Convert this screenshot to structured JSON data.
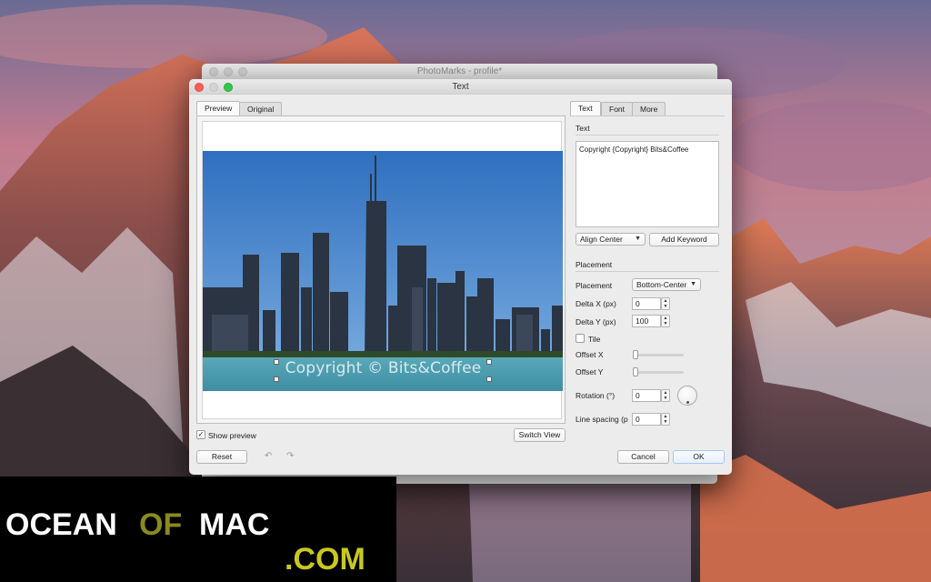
{
  "bg_window": {
    "title": "PhotoMarks - profile*"
  },
  "dialog": {
    "title": "Text",
    "left_tabs": [
      "Preview",
      "Original"
    ],
    "preview": {
      "watermark_text": "Copyright © Bits&Coffee",
      "show_preview_label": "Show preview",
      "show_preview_checked": true,
      "switch_view_label": "Switch View"
    },
    "reset_label": "Reset",
    "undo_icon": "undo-arrow-icon",
    "redo_icon": "redo-arrow-icon",
    "right_tabs": [
      "Text",
      "Font",
      "More"
    ],
    "text_section": {
      "title": "Text",
      "value": "Copyright {Copyright} Bits&Coffee",
      "align_value": "Align Center",
      "add_keyword_label": "Add Keyword"
    },
    "placement_section": {
      "title": "Placement",
      "placement_label": "Placement",
      "placement_value": "Bottom-Center",
      "delta_x_label": "Delta X (px)",
      "delta_x_value": "0",
      "delta_y_label": "Delta Y (px)",
      "delta_y_value": "100",
      "tile_label": "Tile",
      "tile_checked": false,
      "offset_x_label": "Offset X",
      "offset_x_value": 0,
      "offset_y_label": "Offset Y",
      "offset_y_value": 0,
      "rotation_label": "Rotation (°)",
      "rotation_value": "0",
      "line_spacing_label": "Line spacing (p",
      "line_spacing_value": "0"
    },
    "cancel_label": "Cancel",
    "ok_label": "OK"
  },
  "banner": {
    "ocean": "OCEAN",
    "of": "OF",
    "mac": "MAC",
    "com": ".COM"
  },
  "colors": {
    "accent_of": "#8a8a1f",
    "accent_com": "#c8c81f",
    "close": "#fc5f57",
    "maximize": "#35c749"
  }
}
